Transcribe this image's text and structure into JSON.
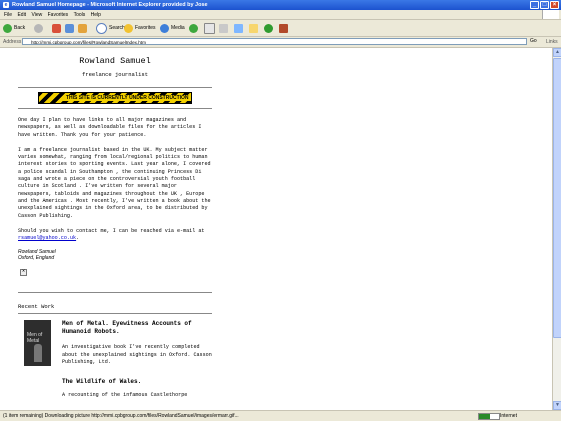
{
  "window": {
    "title": "Rowland Samuel Homepage - Microsoft Internet Explorer provided by Jose",
    "minimize": "_",
    "maximize": "□",
    "close": "×"
  },
  "menu": [
    "File",
    "Edit",
    "View",
    "Favorites",
    "Tools",
    "Help"
  ],
  "toolbar": {
    "back": "Back",
    "search": "Search",
    "favorites": "Favorites",
    "media": "Media"
  },
  "address": {
    "label": "Address",
    "url": "http://mmi.cpbgroup.com/files/RowlandSamuelIndex.htm",
    "go": "Go",
    "links": "Links"
  },
  "page": {
    "name": "Rowland Samuel",
    "role": "freelance journalist",
    "banner": "THIS SITE IS CURRENTLY UNDER CONSTRUCTION",
    "para1": "One day I plan to have links to all major magazines and newspapers, as well as downloadable files for the articles I have written. Thank you for your patience.",
    "para2": "I am a freelance journalist based in the UK. My subject matter varies somewhat, ranging from local/regional politics to human interest stories to sporting events. Last year alone, I covered a police scandal in Southampton , the continuing Princess Di saga and wrote a piece on the controversial youth football culture in Scotland . I've written for several major newspapers, tabloids and magazines throughout the UK , Europe and the Americas . Most recently, I've written a book about the unexplained sightings in the Oxford area, to be distributed by Casson Publishing.",
    "contact_before": "Should you wish to contact me, I can be reached via e-mail at ",
    "email": "rsamuel@yahoo.co.uk",
    "contact_after": ".",
    "sig_name": "Rowland Samuel",
    "sig_place": "Oxford, England",
    "recent_heading": "Recent Work",
    "books": [
      {
        "title": "Men of Metal. Eyewitness Accounts of Humanoid Robots.",
        "desc": "An investigative book I've recently completed about the unexplained sightings in Oxford. Casson Publishing, Ltd.",
        "cover_text": "Men of Metal"
      },
      {
        "title": "The Wildlife of Wales.",
        "desc": "A recounting of the infamous Castlethorpe"
      }
    ]
  },
  "status": {
    "text": "(1 item remaining) Downloading picture http://mmi.cpbgroup.com/files/RowlandSamuel/images/ermarr.gif...",
    "zone": "Internet",
    "progress": 0.55
  }
}
